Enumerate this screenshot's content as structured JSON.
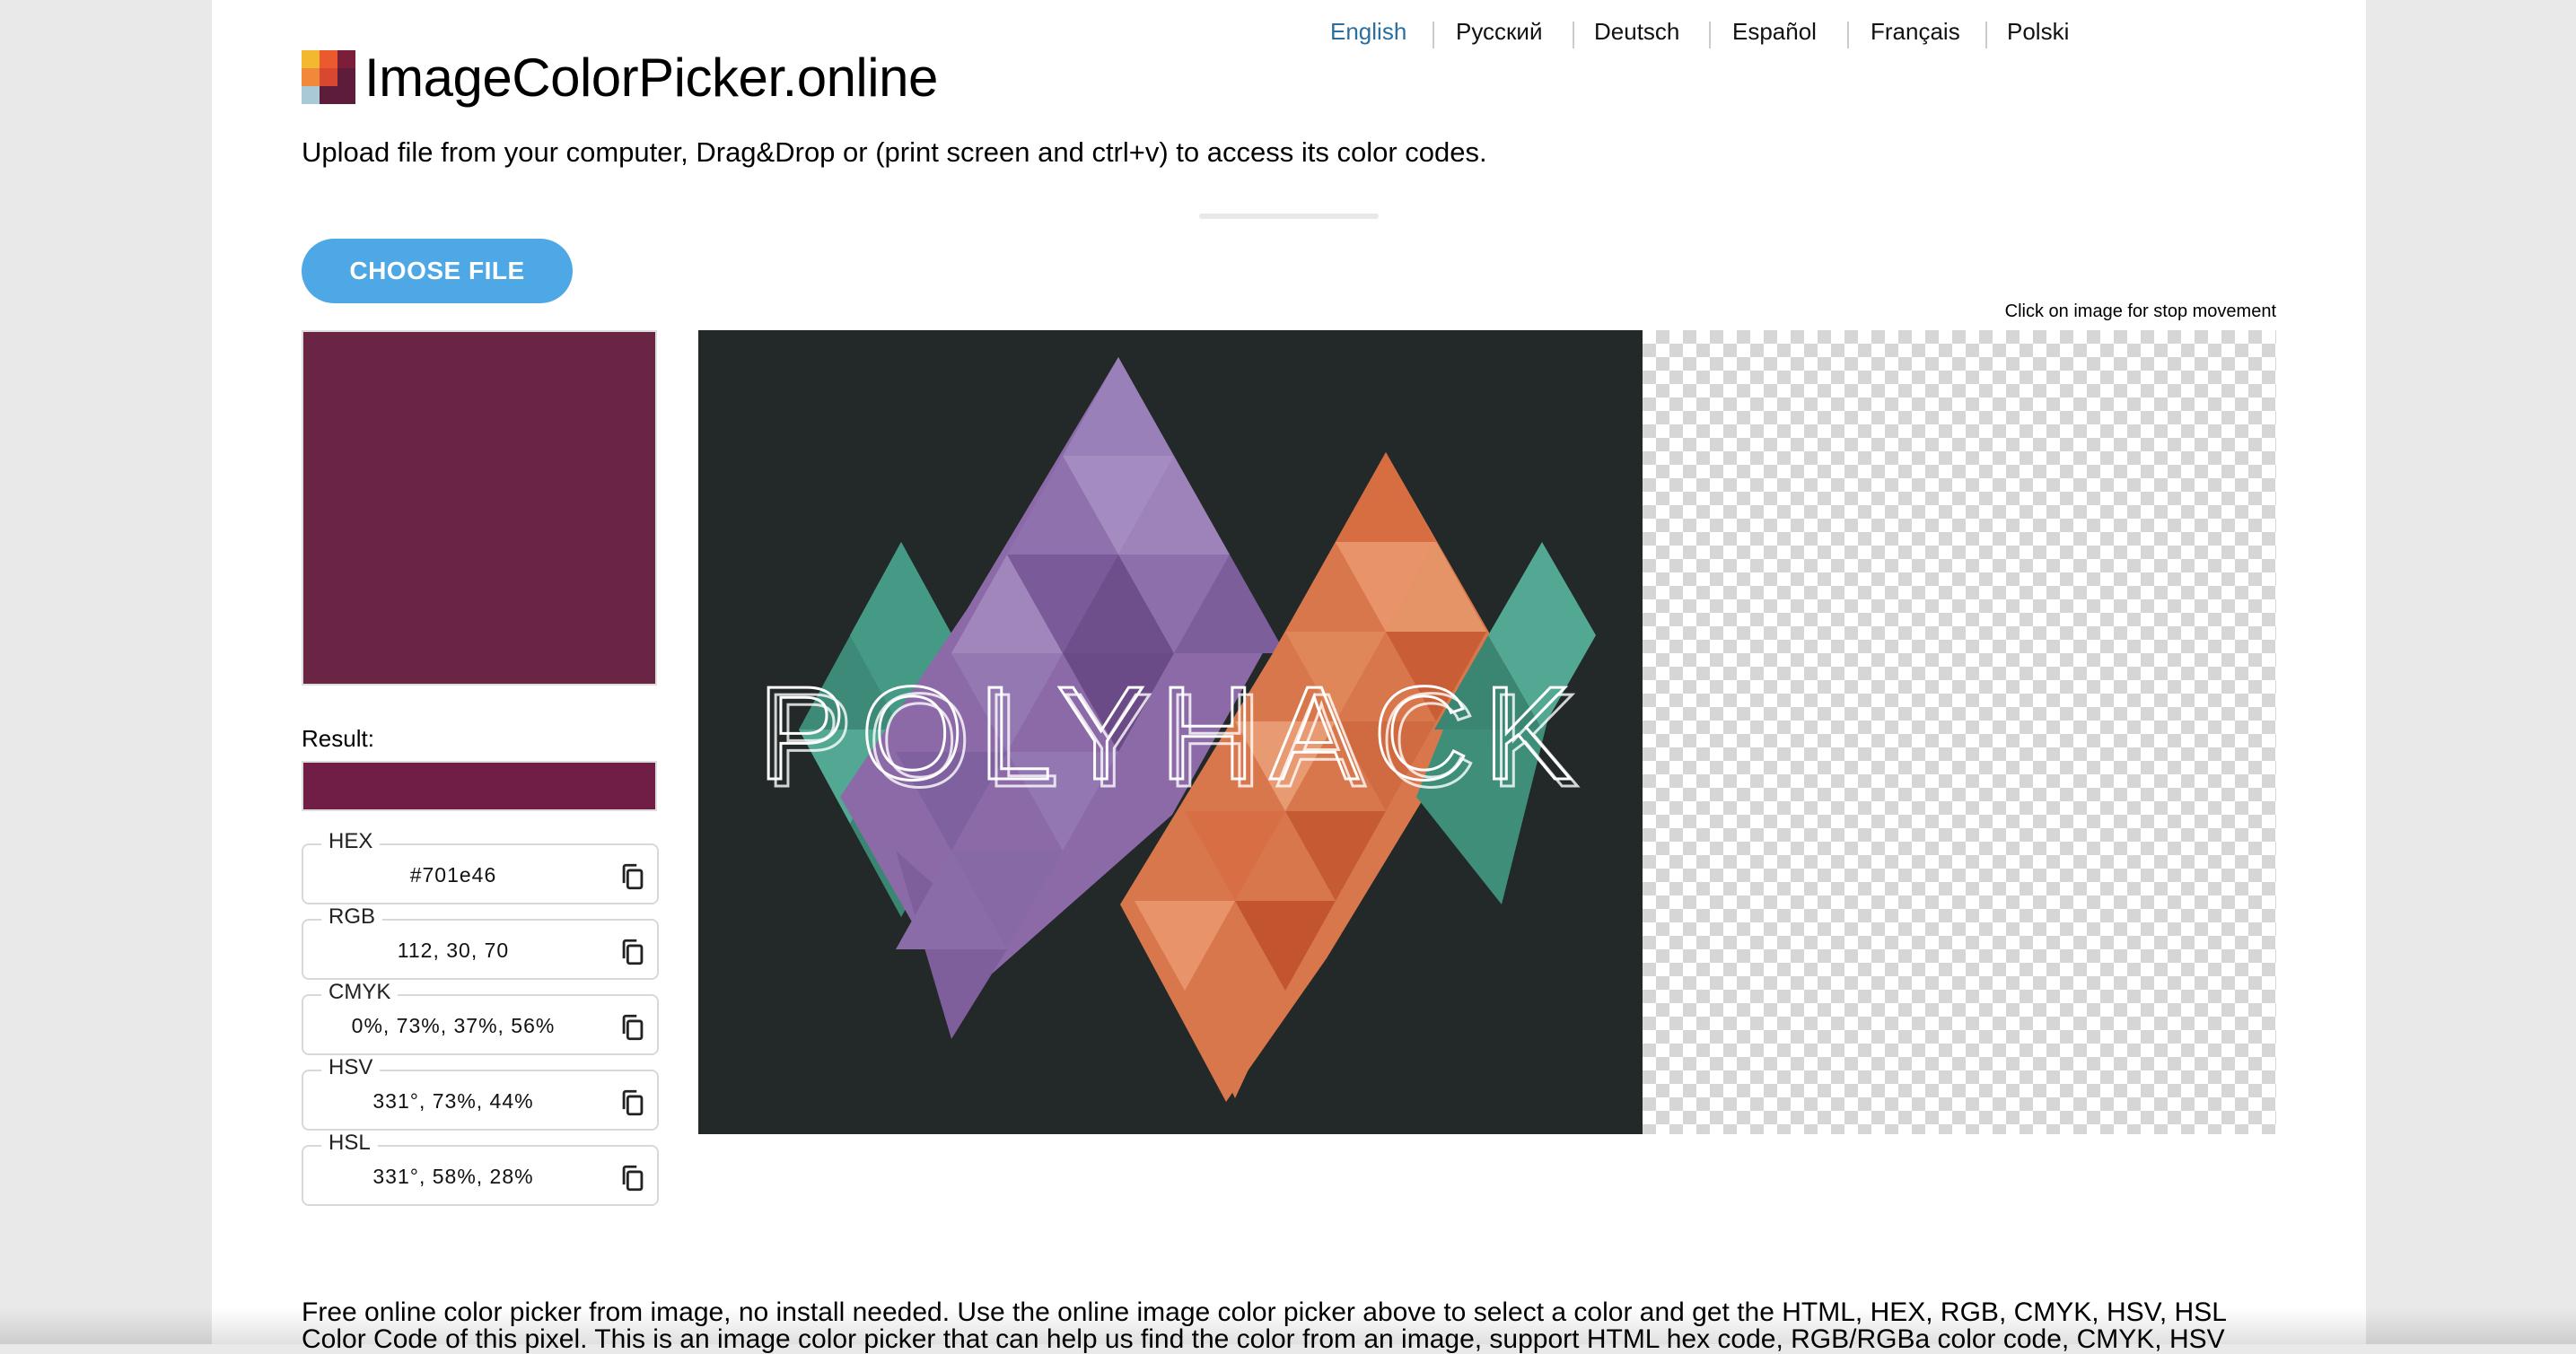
{
  "languages": [
    {
      "label": "English",
      "active": true
    },
    {
      "label": "Русский",
      "active": false
    },
    {
      "label": "Deutsch",
      "active": false
    },
    {
      "label": "Español",
      "active": false
    },
    {
      "label": "Français",
      "active": false
    },
    {
      "label": "Polski",
      "active": false
    }
  ],
  "header": {
    "title": "ImageColorPicker.online",
    "subtitle": "Upload file from your computer, Drag&Drop or (print screen and ctrl+v) to access its color codes."
  },
  "upload": {
    "button_label": "CHOOSE FILE"
  },
  "hint": "Click on image for stop movement",
  "result": {
    "label": "Result:",
    "color": "#701e46",
    "preview_color": "#6a2444"
  },
  "fields": [
    {
      "label": "HEX",
      "value": "#701e46"
    },
    {
      "label": "RGB",
      "value": "112, 30, 70"
    },
    {
      "label": "CMYK",
      "value": "0%, 73%, 37%, 56%"
    },
    {
      "label": "HSV",
      "value": "331°, 73%, 44%"
    },
    {
      "label": "HSL",
      "value": "331°, 58%, 28%"
    }
  ],
  "image": {
    "logo_text": "POLYHACK",
    "background": "#232828"
  },
  "zoom_cells": [
    "#ffffff",
    "#6a2444",
    "#ffffff",
    "#ffffff",
    "#ffffff",
    "#7a1f2a",
    "#6b4a2a",
    "#6e2a1e",
    "#7a2426"
  ],
  "description": "Free online color picker from image, no install needed. Use the online image color picker above to select a color and get the HTML, HEX, RGB, CMYK, HSV, HSL Color Code of this pixel. This is an image color picker that can help us find the color from an image, support HTML hex code, RGB/RGBa color code, CMYK, HSV"
}
